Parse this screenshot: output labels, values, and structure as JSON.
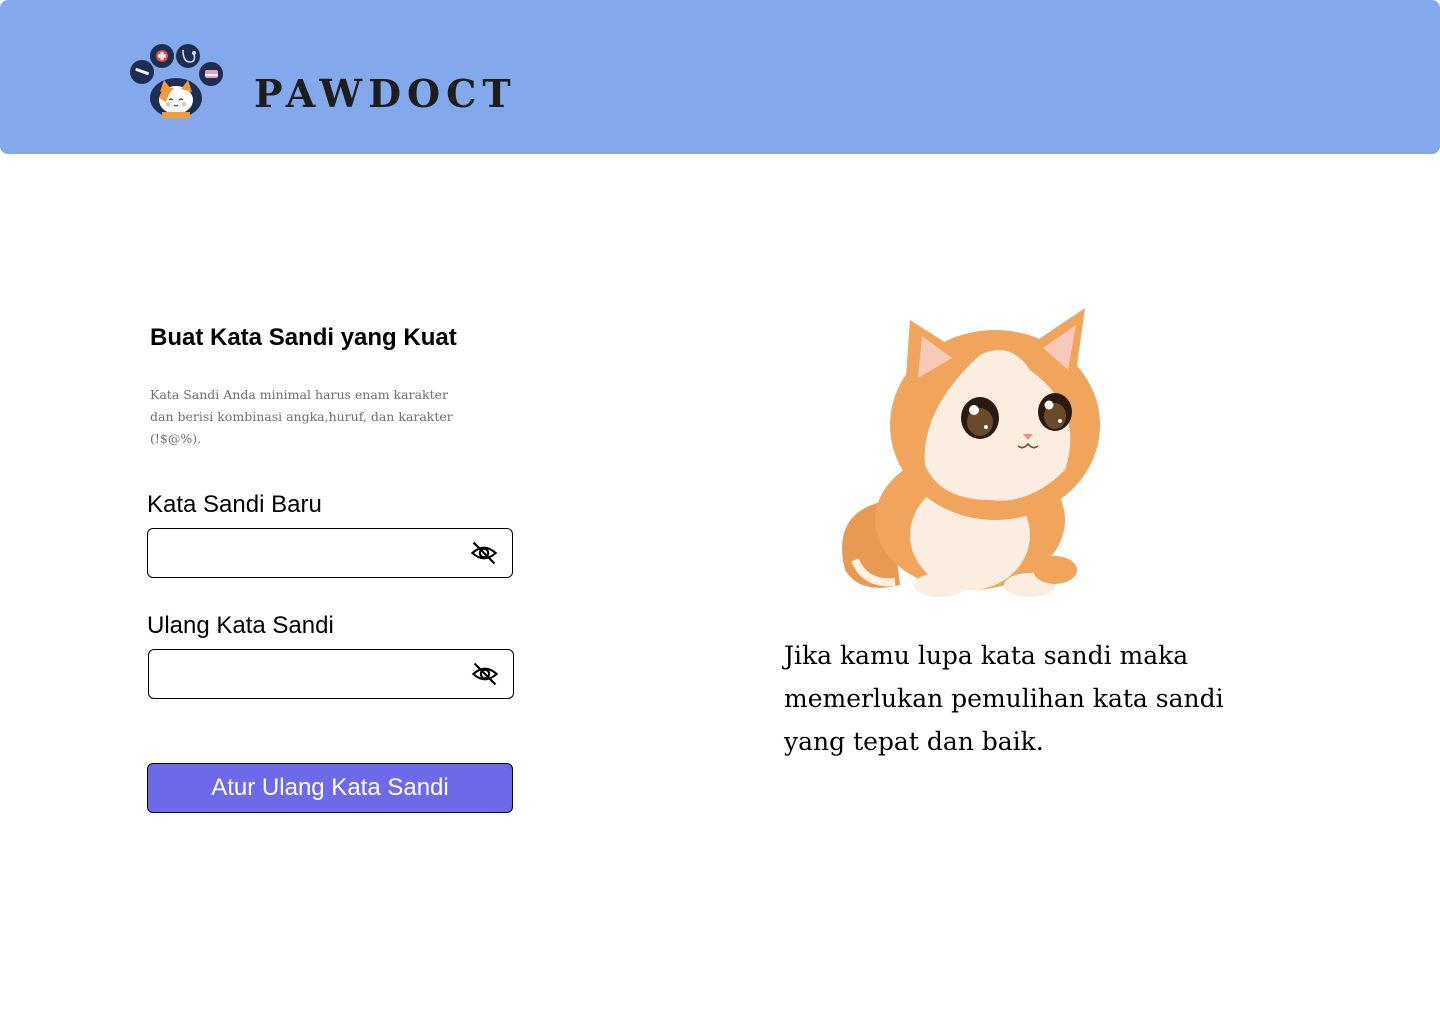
{
  "app": {
    "brand": "PAWDOCT",
    "logo_icon": "paw-logo-icon"
  },
  "reset_form": {
    "title": "Buat Kata Sandi yang Kuat",
    "description": "Kata Sandi Anda minimal harus enam karakter dan berisi kombinasi angka,huruf, dan karakter (!$@%).",
    "new_password": {
      "label": "Kata Sandi Baru",
      "value": "",
      "toggle_icon": "eye-off-icon"
    },
    "confirm_password": {
      "label": "Ulang Kata Sandi",
      "value": "",
      "toggle_icon": "eye-off-icon"
    },
    "submit_label": "Atur Ulang Kata Sandi"
  },
  "side_panel": {
    "illustration": "kitten-illustration",
    "message": "Jika kamu lupa kata sandi maka memerlukan pemulihan kata sandi yang tepat dan baik."
  },
  "colors": {
    "header_bg": "#84a8ec",
    "button_bg": "#6e69e8",
    "button_text": "#ffffff"
  }
}
